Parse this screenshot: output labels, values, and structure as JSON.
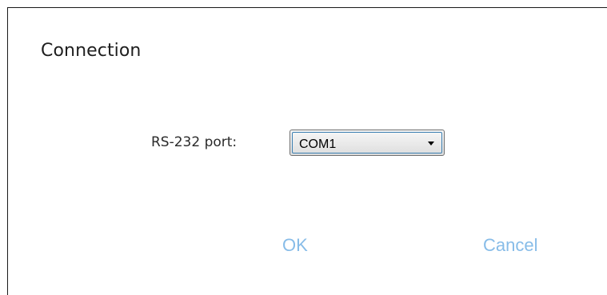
{
  "dialog": {
    "title": "Connection",
    "port": {
      "label": "RS-232 port:",
      "selected": "COM1"
    },
    "buttons": {
      "ok": "OK",
      "cancel": "Cancel"
    }
  },
  "colors": {
    "button_text": "#87bce8",
    "focus_border": "#3c7fb1"
  }
}
